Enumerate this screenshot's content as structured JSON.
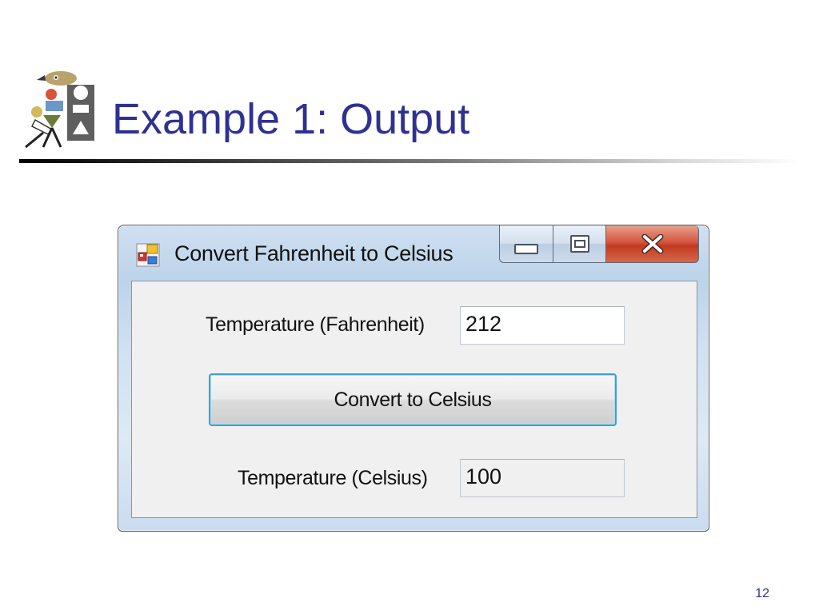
{
  "slide": {
    "title": "Example 1: Output",
    "page_number": "12"
  },
  "window": {
    "title": "Convert Fahrenheit to Celsius",
    "caption_buttons": [
      "minimize",
      "maximize",
      "close"
    ],
    "close_glyph": "X"
  },
  "form": {
    "fahrenheit_label": "Temperature (Fahrenheit)",
    "fahrenheit_value": "212",
    "convert_button_label": "Convert to Celsius",
    "celsius_label": "Temperature (Celsius)",
    "celsius_value": "100"
  },
  "colors": {
    "title_text": "#2f3192",
    "close_button": "#c9432a",
    "button_focus_border": "#3c9fd3"
  },
  "icons": {
    "logo": "decorative-shapes-logo-icon",
    "app": "form-app-icon",
    "minimize": "minimize-icon",
    "maximize": "maximize-icon",
    "close": "close-icon"
  }
}
